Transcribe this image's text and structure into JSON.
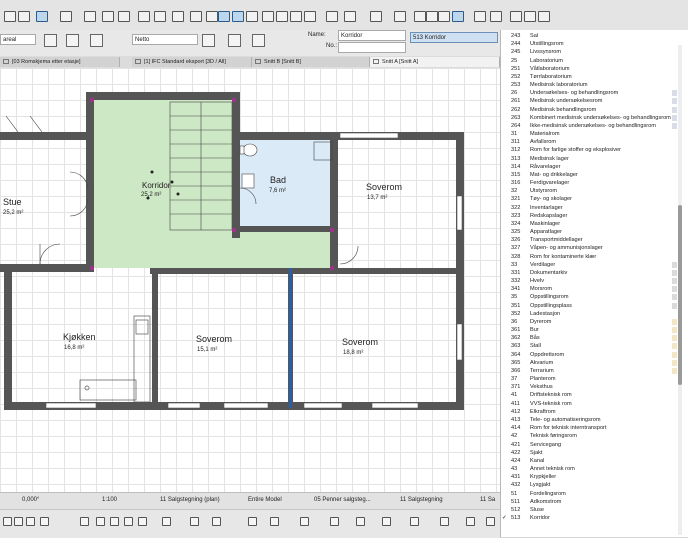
{
  "toolbar": {
    "layer_field": "areal",
    "netto_field": "Netto",
    "name_label": "Name:",
    "name_value": "Korridor",
    "no_label": "No.:",
    "zone_field": "513  Korridor"
  },
  "tabs": [
    {
      "label": "[03 Romskjema etter etasje]"
    },
    {
      "label": "[1] IFC Standard eksport [3D / All]"
    },
    {
      "label": "Snitt B [Snitt B]"
    },
    {
      "label": "Snitt A [Snitt A]"
    }
  ],
  "rooms": [
    {
      "name": "Stue",
      "area": "25,2 m²"
    },
    {
      "name": "Korridor",
      "area": "25,2 m²"
    },
    {
      "name": "Bad",
      "area": "7,6 m²"
    },
    {
      "name": "Soverom",
      "area": "13,7 m²"
    },
    {
      "name": "Kjøkken",
      "area": "16,8 m²"
    },
    {
      "name": "Soverom",
      "area": "15,1 m²"
    },
    {
      "name": "Soverom",
      "area": "18,8 m²"
    }
  ],
  "status": {
    "angle": "0,000°",
    "scale": "1:100",
    "layer_combo": "11 Salgstegning (plan)",
    "model_view": "Entire Model",
    "pen_set": "05 Penner salgsteg...",
    "dim": "11 Salgstegning",
    "right": "11 Sa"
  },
  "zone_list": [
    {
      "code": "243",
      "name": "Sal",
      "swatch": ""
    },
    {
      "code": "244",
      "name": "Utstillingsrom",
      "swatch": ""
    },
    {
      "code": "245",
      "name": "Livssynsrom",
      "swatch": ""
    },
    {
      "code": "25",
      "name": "Laboratorium",
      "swatch": ""
    },
    {
      "code": "251",
      "name": "Våtlaboratorium",
      "swatch": ""
    },
    {
      "code": "252",
      "name": "Tørrlaboratorium",
      "swatch": ""
    },
    {
      "code": "253",
      "name": "Medisinsk laboratorium",
      "swatch": ""
    },
    {
      "code": "26",
      "name": "Undersøkelses- og behandlingsrom",
      "swatch": "#dadce6"
    },
    {
      "code": "261",
      "name": "Medisinsk undersøkelsesrom",
      "swatch": "#dadce6"
    },
    {
      "code": "262",
      "name": "Medisinsk behandlingsrom",
      "swatch": "#dadce6"
    },
    {
      "code": "263",
      "name": "Kombinert medisinsk undersøkelses- og behandlingsrom",
      "swatch": "#dadce6"
    },
    {
      "code": "264",
      "name": "Ikke-medisinsk undersøkelses- og behandlingsrom",
      "swatch": "#dadce6"
    },
    {
      "code": "31",
      "name": "Materialrom",
      "swatch": ""
    },
    {
      "code": "311",
      "name": "Avfallsrom",
      "swatch": ""
    },
    {
      "code": "312",
      "name": "Rom for farlige stoffer og eksplosiver",
      "swatch": ""
    },
    {
      "code": "313",
      "name": "Medisinsk lager",
      "swatch": ""
    },
    {
      "code": "314",
      "name": "Råvarelager",
      "swatch": ""
    },
    {
      "code": "315",
      "name": "Mat- og drikkelager",
      "swatch": ""
    },
    {
      "code": "316",
      "name": "Ferdigvarelager",
      "swatch": ""
    },
    {
      "code": "32",
      "name": "Utstyrsrom",
      "swatch": ""
    },
    {
      "code": "321",
      "name": "Tøy- og skolager",
      "swatch": ""
    },
    {
      "code": "322",
      "name": "Inventarlager",
      "swatch": ""
    },
    {
      "code": "323",
      "name": "Redskapslager",
      "swatch": ""
    },
    {
      "code": "324",
      "name": "Maskinlager",
      "swatch": ""
    },
    {
      "code": "325",
      "name": "Apparatlager",
      "swatch": ""
    },
    {
      "code": "326",
      "name": "Transportmiddellager",
      "swatch": ""
    },
    {
      "code": "327",
      "name": "Våpen- og ammunisjonslager",
      "swatch": ""
    },
    {
      "code": "328",
      "name": "Rom for kontaminerte klær",
      "swatch": ""
    },
    {
      "code": "33",
      "name": "Verdilager",
      "swatch": "#dadada"
    },
    {
      "code": "331",
      "name": "Dokumentarkiv",
      "swatch": "#dadada"
    },
    {
      "code": "332",
      "name": "Hvelv",
      "swatch": "#dadada"
    },
    {
      "code": "341",
      "name": "Morsrom",
      "swatch": "#dadada"
    },
    {
      "code": "35",
      "name": "Oppstillingsrom",
      "swatch": "#dadada"
    },
    {
      "code": "351",
      "name": "Oppstillingsplass",
      "swatch": "#dadada"
    },
    {
      "code": "352",
      "name": "Ladestasjon",
      "swatch": ""
    },
    {
      "code": "36",
      "name": "Dyrerom",
      "swatch": "#f0e6c8"
    },
    {
      "code": "361",
      "name": "Bur",
      "swatch": "#f0e6c8"
    },
    {
      "code": "362",
      "name": "Bås",
      "swatch": "#f0e6c8"
    },
    {
      "code": "363",
      "name": "Stall",
      "swatch": "#f0e6c8"
    },
    {
      "code": "364",
      "name": "Oppdrettsrom",
      "swatch": "#f0e6c8"
    },
    {
      "code": "365",
      "name": "Akvarium",
      "swatch": "#f0e6c8"
    },
    {
      "code": "366",
      "name": "Terrarium",
      "swatch": "#f0e6c8"
    },
    {
      "code": "37",
      "name": "Planterom",
      "swatch": ""
    },
    {
      "code": "371",
      "name": "Veksthus",
      "swatch": ""
    },
    {
      "code": "41",
      "name": "Driftsteknisk rom",
      "swatch": ""
    },
    {
      "code": "411",
      "name": "VVS-teknisk rom",
      "swatch": ""
    },
    {
      "code": "412",
      "name": "Elkraftrom",
      "swatch": ""
    },
    {
      "code": "413",
      "name": "Tele- og automatiseringsrom",
      "swatch": ""
    },
    {
      "code": "414",
      "name": "Rom for teknisk interntransport",
      "swatch": ""
    },
    {
      "code": "42",
      "name": "Teknisk føringsrom",
      "swatch": ""
    },
    {
      "code": "421",
      "name": "Servicegang",
      "swatch": ""
    },
    {
      "code": "422",
      "name": "Sjakt",
      "swatch": ""
    },
    {
      "code": "424",
      "name": "Kanal",
      "swatch": ""
    },
    {
      "code": "43",
      "name": "Annet teknisk rom",
      "swatch": ""
    },
    {
      "code": "431",
      "name": "Krypkjeller",
      "swatch": ""
    },
    {
      "code": "432",
      "name": "Lysgjakt",
      "swatch": ""
    },
    {
      "code": "51",
      "name": "Fordelingsrom",
      "swatch": ""
    },
    {
      "code": "511",
      "name": "Adkomstrom",
      "swatch": ""
    },
    {
      "code": "512",
      "name": "Sluse",
      "swatch": ""
    },
    {
      "code": "513",
      "name": "Korridor",
      "swatch": "",
      "checked": "✓"
    }
  ]
}
